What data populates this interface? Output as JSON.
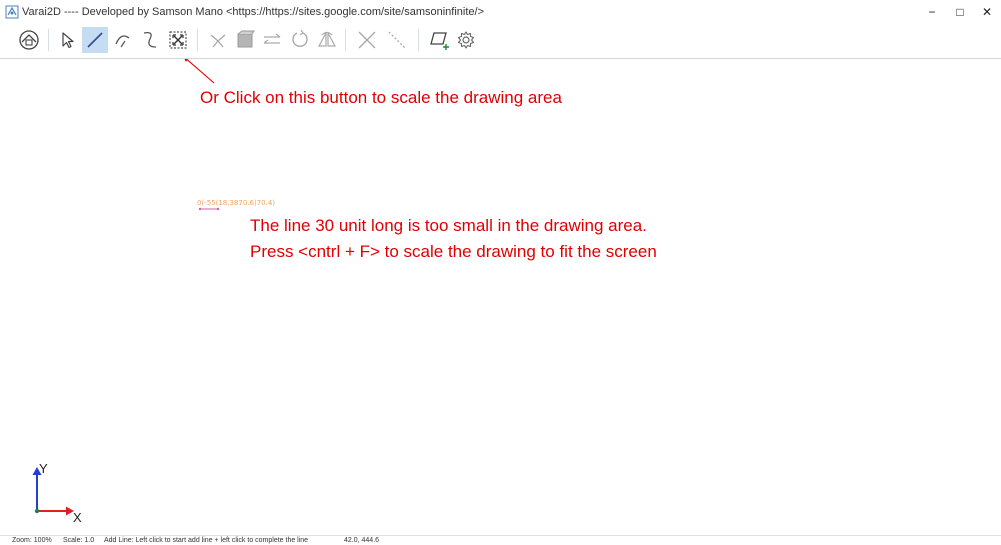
{
  "window": {
    "title": "Varai2D ---- Developed by Samson Mano <https://https://sites.google.com/site/samsoninfinite/>",
    "minimize": "−",
    "maximize": "□",
    "close": "✕"
  },
  "toolbar": {
    "active_tool": "add-line",
    "tools": [
      "home",
      "select",
      "add-line",
      "add-arc",
      "add-curve",
      "scale-to-fit",
      "trim",
      "fill",
      "mirror",
      "rotate",
      "flip",
      "delete",
      "dashed-line",
      "add-shape",
      "settings"
    ]
  },
  "annotations": {
    "button_note": "Or Click on this button to scale the drawing area",
    "line1": "The line 30 unit long is too small in the drawing area.",
    "line2": "Press <cntrl + F> to scale the drawing to fit the screen"
  },
  "canvas": {
    "coord_label": "0(-55(18,3870.6)70.4)"
  },
  "axes": {
    "y": "Y",
    "x": "X"
  },
  "colors": {
    "annotation": "#e00000",
    "axis_y": "#1f3fd6",
    "axis_x": "#e02020",
    "axis_origin": "#1c8a2e",
    "active_tool_bg": "#c5dcf3"
  },
  "status": {
    "zoom": "Zoom: 100%",
    "scale": "Scale: 1.0",
    "message": "Add Line: Left click to start add line + left click to complete the line",
    "coords": "42.0, 444.6"
  }
}
